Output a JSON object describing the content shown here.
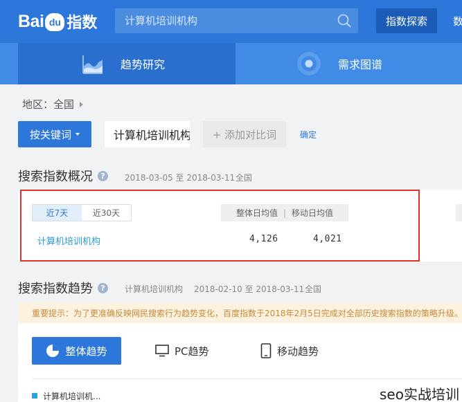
{
  "header": {
    "logo_text": "Bai",
    "logo_paw": "du",
    "logo_suffix": "指数",
    "search_placeholder": "计算机培训机构",
    "explore_label": "指数探索",
    "nav_cut": "数"
  },
  "tabs": [
    {
      "label": "趋势研究",
      "active": true
    },
    {
      "label": "需求图谱",
      "active": false
    }
  ],
  "region": {
    "label": "地区：全国"
  },
  "keyword": {
    "mode_label": "按关键词",
    "value": "计算机培训机构",
    "add_compare": "+ 添加对比词",
    "confirm": "确定"
  },
  "overview": {
    "title": "搜索指数概况",
    "date_range": "2018-03-05 至 2018-03-11",
    "region": "全国",
    "range_tabs": [
      "近7天",
      "近30天"
    ],
    "active_range": 0,
    "col_overall": "整体日均值",
    "col_sep": "|",
    "col_mobile": "移动日均值",
    "rows": [
      {
        "keyword": "计算机培训机构",
        "overall": "4,126",
        "mobile": "4,021"
      }
    ]
  },
  "trend": {
    "title": "搜索指数趋势",
    "keyword": "计算机培训机构",
    "date_range": "2018-02-10 至 2018-03-11",
    "region": "全国",
    "notice": "重要提示：为了更准确反映网民搜索行为趋势变化，百度指数于2018年2月5日完成对全部历史搜索指数的策略升级。",
    "modes": [
      "整体趋势",
      "PC趋势",
      "移动趋势"
    ],
    "legend": "计算机培训机..."
  },
  "watermark": "seo实战培训",
  "colors": {
    "brand_blue": "#2c77d9",
    "tab_bar": "#3f8be6",
    "highlight_outline": "#e0302e",
    "legend_series": "#2aa0e0"
  }
}
